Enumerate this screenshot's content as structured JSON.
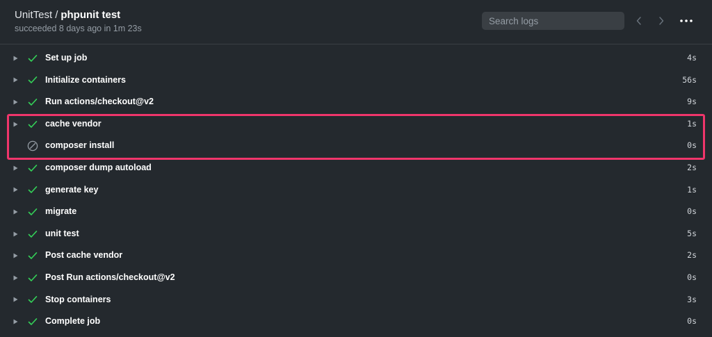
{
  "header": {
    "workflow": "UnitTest",
    "separator": "/",
    "job": "phpunit test",
    "subtitle": "succeeded 8 days ago in 1m 23s",
    "search_placeholder": "Search logs",
    "prev_icon": "chevron-left-icon",
    "next_icon": "chevron-right-icon",
    "more_icon": "kebab-horizontal-icon"
  },
  "colors": {
    "background": "#24292e",
    "success": "#34d058",
    "skipped": "#959da5",
    "highlight": "#f0356b"
  },
  "steps": [
    {
      "name": "Set up job",
      "duration": "4s",
      "status": "success"
    },
    {
      "name": "Initialize containers",
      "duration": "56s",
      "status": "success"
    },
    {
      "name": "Run actions/checkout@v2",
      "duration": "9s",
      "status": "success"
    },
    {
      "name": "cache vendor",
      "duration": "1s",
      "status": "success"
    },
    {
      "name": "composer install",
      "duration": "0s",
      "status": "skipped"
    },
    {
      "name": "composer dump autoload",
      "duration": "2s",
      "status": "success"
    },
    {
      "name": "generate key",
      "duration": "1s",
      "status": "success"
    },
    {
      "name": "migrate",
      "duration": "0s",
      "status": "success"
    },
    {
      "name": "unit test",
      "duration": "5s",
      "status": "success"
    },
    {
      "name": "Post cache vendor",
      "duration": "2s",
      "status": "success"
    },
    {
      "name": "Post Run actions/checkout@v2",
      "duration": "0s",
      "status": "success"
    },
    {
      "name": "Stop containers",
      "duration": "3s",
      "status": "success"
    },
    {
      "name": "Complete job",
      "duration": "0s",
      "status": "success"
    }
  ]
}
